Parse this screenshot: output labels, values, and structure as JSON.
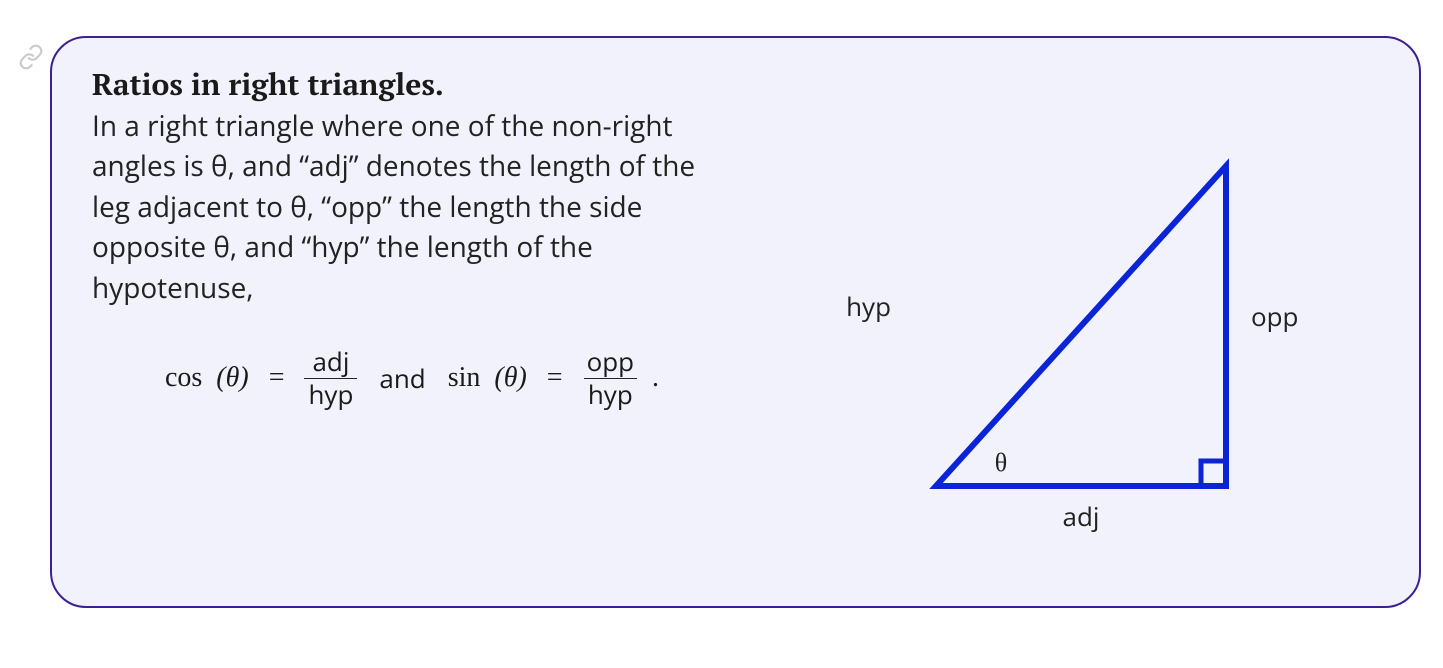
{
  "callout": {
    "heading": "Ratios in right triangles.",
    "body": "In a right triangle where one of the non-right angles is θ, and “adj” denotes the length of the leg adjacent to θ, “opp” the length the side opposite θ, and “hyp” the length of the hypotenuse,",
    "formula": {
      "cos_fn": "cos",
      "sin_fn": "sin",
      "arg": "(θ)",
      "eq": "=",
      "adj": "adj",
      "opp": "opp",
      "hyp": "hyp",
      "and": "and",
      "period": "."
    }
  },
  "figure": {
    "hyp_label": "hyp",
    "opp_label": "opp",
    "adj_label": "adj",
    "theta_label": "θ",
    "stroke_color": "#0b24d6"
  }
}
